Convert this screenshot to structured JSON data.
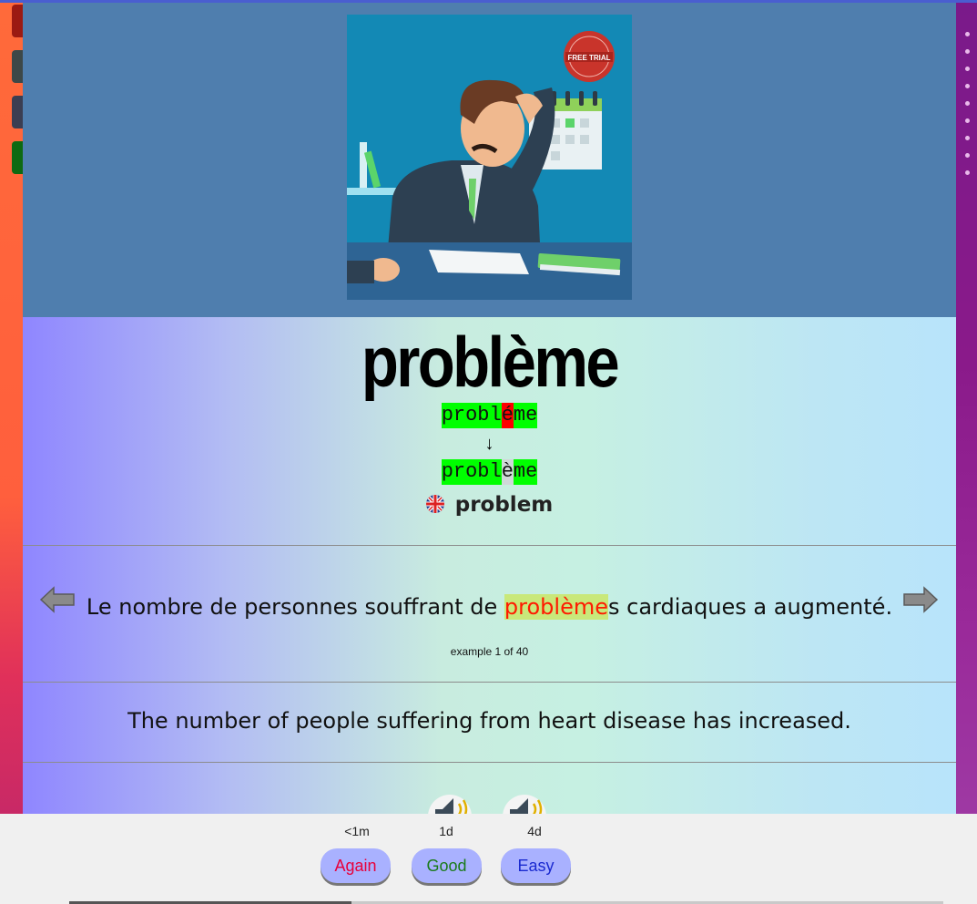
{
  "card": {
    "word": "problème",
    "diff_input": [
      "probl",
      "é",
      "me"
    ],
    "arrow": "↓",
    "diff_correct": [
      "probl",
      "è",
      "me"
    ],
    "translation": "problem",
    "sentence_before": "Le nombre de personnes souffrant de ",
    "sentence_highlight": "problème",
    "sentence_after": "s cardiaques a augmenté.",
    "example_counter": "example 1 of 40",
    "sentence_translation": "The number of people suffering from heart disease has increased."
  },
  "image": {
    "badge_text": "FREE TRIAL",
    "icon": "stressed-man-illustration"
  },
  "answers": [
    {
      "interval": "<1m",
      "label": "Again",
      "color": "#e8003a"
    },
    {
      "interval": "1d",
      "label": "Good",
      "color": "#1a7a1a"
    },
    {
      "interval": "4d",
      "label": "Easy",
      "color": "#1a2ad0"
    }
  ],
  "colors": {
    "diff_ok": "#00ff00",
    "diff_wrong": "#ff0000",
    "highlight_bg": "#c9e87a",
    "highlight_text": "#ff1a00",
    "image_band": "#4f7eae",
    "button_bg": "#a9b1ff"
  }
}
